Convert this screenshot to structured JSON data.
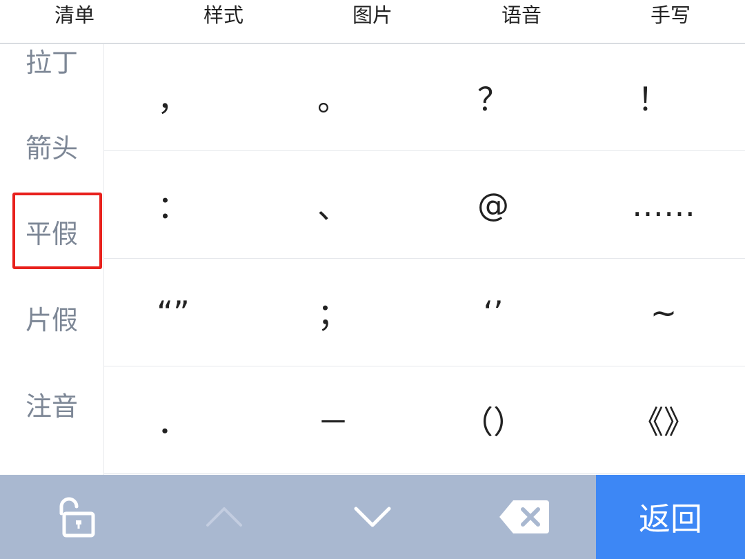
{
  "top_tabs": [
    "清单",
    "样式",
    "图片",
    "语音",
    "手写"
  ],
  "sidebar": {
    "items": [
      "拉丁",
      "箭头",
      "平假",
      "片假",
      "注音"
    ],
    "selected": "平假"
  },
  "symbols": [
    [
      "，",
      "。",
      "？",
      "！"
    ],
    [
      "：",
      "、",
      "@",
      "……"
    ],
    [
      "“”",
      "；",
      "‘’",
      "~"
    ],
    [
      "．",
      "－",
      "（）",
      "《》"
    ]
  ],
  "bottom_bar": {
    "lock_icon": "unlock-icon",
    "up_icon": "chevron-up-icon",
    "down_icon": "chevron-down-icon",
    "delete_icon": "backspace-icon",
    "return_label": "返回"
  },
  "colors": {
    "highlight": "#e8201c",
    "bottom_bar": "#a9b8d0",
    "return_button": "#3d87f5",
    "sidebar_text": "#7d8796"
  }
}
